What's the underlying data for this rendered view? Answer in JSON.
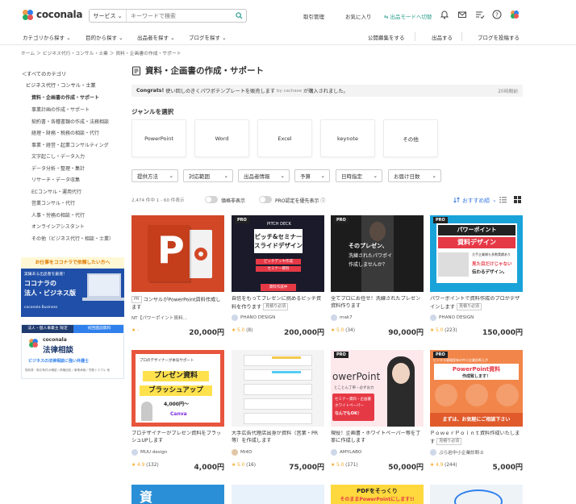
{
  "header": {
    "brand": "coconala",
    "search_category": "サービス",
    "search_placeholder": "キーワードで検索",
    "links": [
      "取引管理",
      "お気に入り",
      "出品モードへ切替"
    ]
  },
  "nav": {
    "left": [
      "カテゴリから探す",
      "目的から探す",
      "出品者を探す",
      "ブログを探す"
    ],
    "right": [
      "公開募集をする",
      "出品する",
      "ブログを投稿する"
    ]
  },
  "breadcrumb": "ホーム ＞ ビジネス代行・コンサル・士業 ＞ 資料・企画書の作成・サポート",
  "sidebar": {
    "all": "＜すべてのカテゴリ",
    "parent": "ビジネス代行・コンサル・士業",
    "items": [
      "資料・企画書の作成・サポート",
      "事業計画の作成・サポート",
      "契約書・各種書類の作成・法務相談",
      "経理・財務・税務の相談・代行",
      "事業・経営・起業コンサルティング",
      "文字起こし・データ入力",
      "データ分析・整理・集計",
      "リサーチ・データ収集",
      "ECコンサル・運用代行",
      "営業コンサル・代行",
      "人事・労務の相談・代行",
      "オンラインアシスタント",
      "その他（ビジネス代行・相談・士業）"
    ]
  },
  "banner1": {
    "top": "お仕事をココナラで依頼したい方へ",
    "sub": "実績ある出品者を厳選！",
    "title1": "ココナラの",
    "title2": "法人・ビジネス版",
    "foot": "coconala Business"
  },
  "banner2": {
    "ribbon1": "法人・個人事業主 限定",
    "ribbon2": "初回面談無料",
    "brand": "coconala",
    "title": "法律相談",
    "sub": "ビジネスの法律相談に強い弁護士",
    "foot": "契約書・取引条件の確認 / 債権回収 / 事業承継 / 労務トラブル 他"
  },
  "main": {
    "title": "資料・企画書の作成・サポート",
    "notice_pre": "Congrats!",
    "notice_text": "使い回しのきくパワポテンプレートを販売します",
    "notice_by": "by cachase",
    "notice_post": "が購入されました。",
    "notice_time": "20時間前",
    "genre_heading": "ジャンルを選択",
    "genres": [
      "PowerPoint",
      "Word",
      "Excel",
      "keynote",
      "その他"
    ],
    "filters": [
      "提供方法",
      "対応範囲",
      "出品者情報",
      "予算",
      "日時指定",
      "お届け日数"
    ],
    "count": "2,474 件中 1 - 60 件表示",
    "toggle1": "価格非表示",
    "toggle2": "PRO認定を優先表示",
    "sort": "おすすめ順"
  },
  "cards": [
    {
      "title": "コンサルがPowerPoint資料作成します",
      "pr": "PR",
      "seller": "NT【パワーポイント資料...",
      "rating": "★ -",
      "reviews": "",
      "price": "20,000円",
      "thumb_text": ""
    },
    {
      "title": "自信をもってプレゼンに挑めるピッチ資料を作ります",
      "tag": "見積り必須",
      "seller": "PHANO DESIGN",
      "rating": "★ 5.0",
      "reviews": "(8)",
      "price": "200,000円",
      "thumb_small": "PITCH DECK",
      "thumb_l1": "ピッチ&セミナー",
      "thumb_l2": "スライドデザイン",
      "thumb_b1": "ピッチデッキ作成",
      "thumb_b2": "セミナー資料",
      "thumb_red": "資料作成中"
    },
    {
      "title": "全てプロにお任せ！洗練されたプレゼン資料作ります",
      "seller": "mak7",
      "rating": "★ 5.0",
      "reviews": "(34)",
      "price": "90,000円",
      "thumb_l1": "そのプレゼン、",
      "thumb_l2": "洗練されたパワポイ",
      "thumb_l3": "作成しませんか？"
    },
    {
      "title": "パワーポイントで資料作成のプロがデザインします",
      "tag": "見積り必須",
      "seller": "PHANO DESIGN",
      "rating": "★ 5.0",
      "reviews": "(223)",
      "price": "150,000円",
      "thumb_l1": "パワーポイント",
      "thumb_l2": "資料デザイン",
      "thumb_b1": "大手企業様も多数実績あり",
      "thumb_b2": "見た目だけじゃない",
      "thumb_b3": "伝わるデザイン。"
    },
    {
      "title": "プロデザイナーがプレゼン資料をブラッシュUPします",
      "seller": "MUU design",
      "rating": "★ 4.9",
      "reviews": "(132)",
      "price": "4,000円",
      "thumb_small": "プロのデザイナーが本気サポート",
      "thumb_l1": "プレゼン資料",
      "thumb_l2": "ブラッシュアップ",
      "thumb_b1": "4,000円〜",
      "thumb_b2": "Canva"
    },
    {
      "title": "大手広告代理店出身が資料（営業・PR等）を作成します",
      "seller": "Mi4D",
      "rating": "★ 5.0",
      "reviews": "(16)",
      "price": "75,000円"
    },
    {
      "title": "現役！企画書・ホワイトペーパー等を丁寧に作成します",
      "seller": "AMYLABO",
      "rating": "★ 5.0",
      "reviews": "(171)",
      "price": "50,000円",
      "thumb_l1": "owerPoint",
      "thumb_small": "とことん丁寧・必ずお力",
      "thumb_b1": "セミナー資料・企画書",
      "thumb_b2": "ホワイトペーパー",
      "thumb_b3": "なんでもOK！"
    },
    {
      "title": "ＰｏｗｅｒＰｏｉｎｔ資料作成いたします",
      "tag": "見積り必須",
      "seller": "ぷら岩中小企業診断士",
      "rating": "★ 4.9",
      "reviews": "(244)",
      "price": "5,000円",
      "thumb_small": "ビジネス資格保有の中小企業診断士が",
      "thumb_l1": "PowerPoint資料",
      "thumb_l2": "作成致します！",
      "thumb_b1": "まずは、お気軽にご相談下さい"
    }
  ],
  "partial": {
    "a": "資",
    "b": "PDFをそっくり",
    "c": "そのままPowerPointにします!!"
  }
}
